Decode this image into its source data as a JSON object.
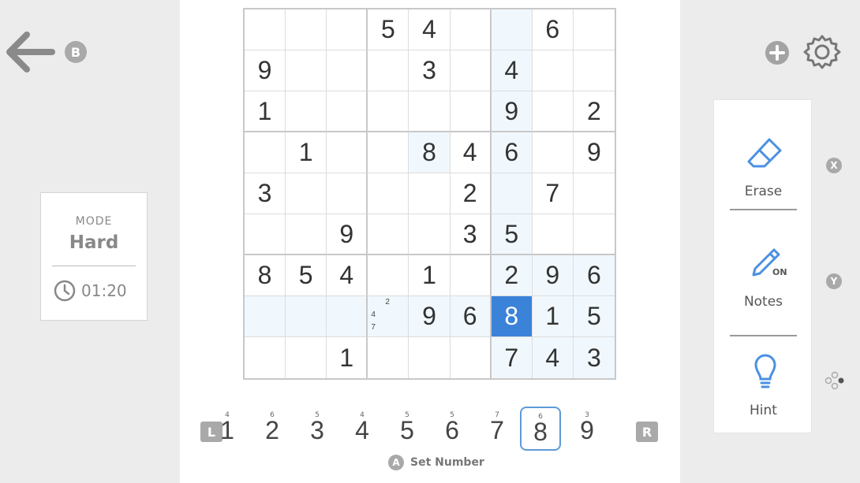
{
  "nav": {
    "back_icon": "arrow-left-icon",
    "back_badge": "B",
    "add_icon": "plus-circle-icon",
    "settings_icon": "gear-icon"
  },
  "mode": {
    "label": "MODE",
    "value": "Hard",
    "timer": "01:20",
    "timer_icon": "clock-icon"
  },
  "board": {
    "grid": [
      [
        "",
        "",
        "",
        "5",
        "4",
        "",
        "",
        "6",
        ""
      ],
      [
        "9",
        "",
        "",
        "",
        "3",
        "",
        "4",
        "",
        ""
      ],
      [
        "1",
        "",
        "",
        "",
        "",
        "",
        "9",
        "",
        "2"
      ],
      [
        "",
        "1",
        "",
        "",
        "8",
        "4",
        "6",
        "",
        "9"
      ],
      [
        "3",
        "",
        "",
        "",
        "",
        "2",
        "",
        "7",
        ""
      ],
      [
        "",
        "",
        "9",
        "",
        "",
        "3",
        "5",
        "",
        ""
      ],
      [
        "8",
        "5",
        "4",
        "",
        "1",
        "",
        "2",
        "9",
        "6"
      ],
      [
        "",
        "",
        "",
        "",
        "9",
        "6",
        "8",
        "1",
        "5"
      ],
      [
        "",
        "",
        "1",
        "",
        "",
        "",
        "7",
        "4",
        "3"
      ]
    ],
    "selected": {
      "row": 7,
      "col": 6
    },
    "highlighted": [
      [
        0,
        6
      ],
      [
        1,
        6
      ],
      [
        2,
        6
      ],
      [
        3,
        6
      ],
      [
        4,
        6
      ],
      [
        5,
        6
      ],
      [
        6,
        6
      ],
      [
        6,
        7
      ],
      [
        6,
        8
      ],
      [
        7,
        0
      ],
      [
        7,
        1
      ],
      [
        7,
        2
      ],
      [
        7,
        3
      ],
      [
        7,
        4
      ],
      [
        7,
        5
      ],
      [
        7,
        7
      ],
      [
        7,
        8
      ],
      [
        8,
        6
      ],
      [
        8,
        7
      ],
      [
        8,
        8
      ],
      [
        3,
        4
      ]
    ],
    "notes": [
      {
        "row": 7,
        "col": 3,
        "values": [
          "2",
          "4",
          "7"
        ]
      }
    ]
  },
  "number_bar": {
    "left_badge": "L",
    "right_badge": "R",
    "numbers": [
      {
        "value": "1",
        "count": "4"
      },
      {
        "value": "2",
        "count": "6"
      },
      {
        "value": "3",
        "count": "5"
      },
      {
        "value": "4",
        "count": "4"
      },
      {
        "value": "5",
        "count": "5"
      },
      {
        "value": "6",
        "count": "5"
      },
      {
        "value": "7",
        "count": "7"
      },
      {
        "value": "8",
        "count": "6"
      },
      {
        "value": "9",
        "count": "3"
      }
    ],
    "active_index": 7,
    "action_badge": "A",
    "action_label": "Set Number"
  },
  "tools": {
    "erase": {
      "label": "Erase",
      "icon": "eraser-icon",
      "badge": "X"
    },
    "notes": {
      "label": "Notes",
      "icon": "pencil-icon",
      "state": "ON",
      "badge": "Y"
    },
    "hint": {
      "label": "Hint",
      "icon": "lightbulb-icon"
    },
    "more_icon": "joystick-dots-icon"
  },
  "colors": {
    "accent": "#3b82d9",
    "highlight": "#f1f8fd",
    "tool_icon": "#4a90e2"
  }
}
